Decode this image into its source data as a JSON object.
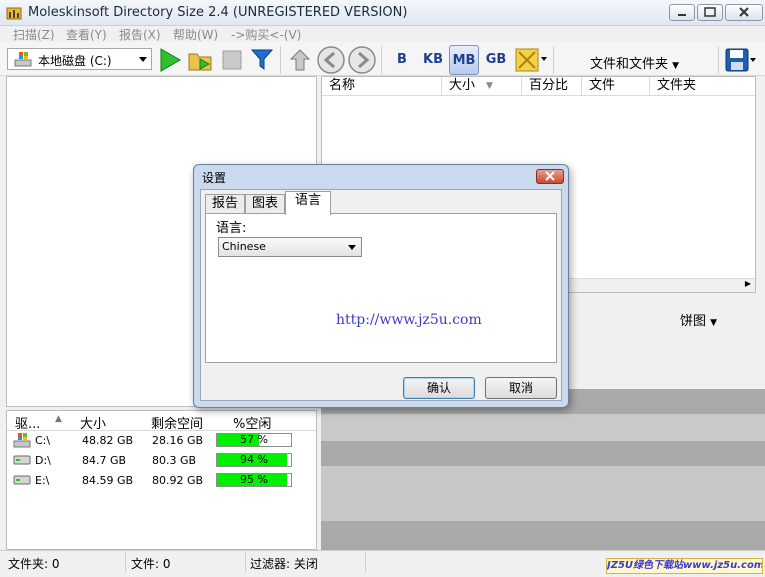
{
  "window": {
    "title": "Moleskinsoft Directory Size 2.4 (UNREGISTERED VERSION)"
  },
  "menu": [
    "扫描(Z)",
    "查看(Y)",
    "报告(X)",
    "帮助(W)",
    "->购买<-(V)"
  ],
  "toolbar": {
    "drive_select": "本地磁盘 (C:)",
    "units": [
      "B",
      "KB",
      "MB",
      "GB"
    ],
    "active_unit": "MB",
    "view_mode": "文件和文件夹"
  },
  "file_list": {
    "columns": [
      "名称",
      "大小",
      "百分比",
      "文件",
      "文件夹"
    ]
  },
  "chart_view": {
    "mode": "饼图"
  },
  "drives": {
    "columns": [
      "驱...",
      "大小",
      "剩余空间",
      "%空闲"
    ],
    "rows": [
      {
        "name": "C:\\",
        "size": "48.82 GB",
        "free": "28.16 GB",
        "pct_label": "57 %",
        "pct": 57
      },
      {
        "name": "D:\\",
        "size": "84.7 GB",
        "free": "80.3 GB",
        "pct_label": "94 %",
        "pct": 94
      },
      {
        "name": "E:\\",
        "size": "84.59 GB",
        "free": "80.92 GB",
        "pct_label": "95 %",
        "pct": 95
      }
    ]
  },
  "status": {
    "folders": "文件夹: 0",
    "files": "文件: 0",
    "filter": "过滤器: 关闭"
  },
  "watermark": "JZ5U绿色下载站www.jz5u.com",
  "dialog": {
    "title": "设置",
    "tabs": [
      "报告",
      "图表",
      "语言"
    ],
    "active_tab": "语言",
    "language_label": "语言:",
    "language_value": "Chinese",
    "url": "http://www.jz5u.com",
    "ok": "确认",
    "cancel": "取消"
  }
}
